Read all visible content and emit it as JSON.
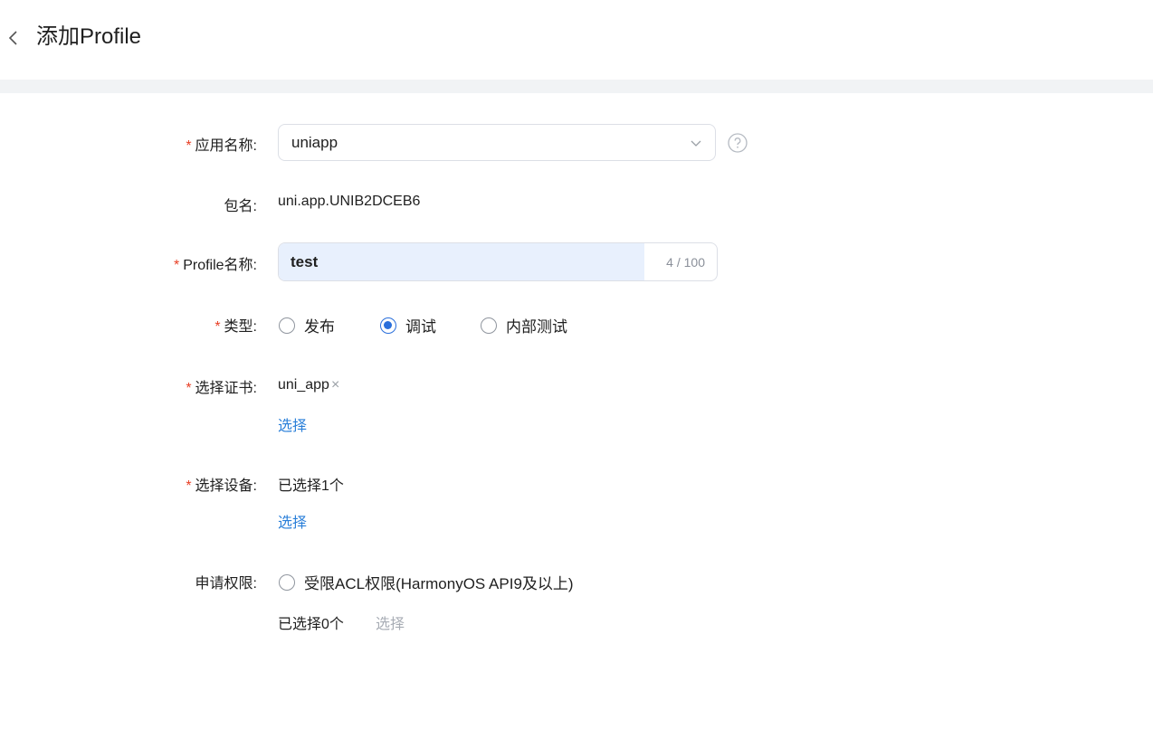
{
  "header": {
    "title": "添加Profile",
    "back_icon": "chevron-left-icon"
  },
  "form": {
    "app_name": {
      "required": "*",
      "label": "应用名称:",
      "value": "uniapp"
    },
    "package": {
      "label": "包名:",
      "value": "uni.app.UNIB2DCEB6"
    },
    "profile_name": {
      "required": "*",
      "label": "Profile名称:",
      "value": "test",
      "counter": "4 / 100"
    },
    "type": {
      "required": "*",
      "label": "类型:",
      "options": [
        {
          "label": "发布",
          "selected": false
        },
        {
          "label": "调试",
          "selected": true
        },
        {
          "label": "内部测试",
          "selected": false
        }
      ]
    },
    "certificate": {
      "required": "*",
      "label": "选择证书:",
      "value": "uni_app",
      "remove": "×",
      "select_link": "选择"
    },
    "device": {
      "required": "*",
      "label": "选择设备:",
      "value": "已选择1个",
      "select_link": "选择"
    },
    "permission": {
      "label": "申请权限:",
      "option": "受限ACL权限(HarmonyOS API9及以上)",
      "value": "已选择0个",
      "select_link": "选择"
    }
  },
  "colors": {
    "accent": "#2a6fdb",
    "required": "#e84026",
    "link": "#2a7fd9",
    "disabled": "#a8adb5"
  }
}
